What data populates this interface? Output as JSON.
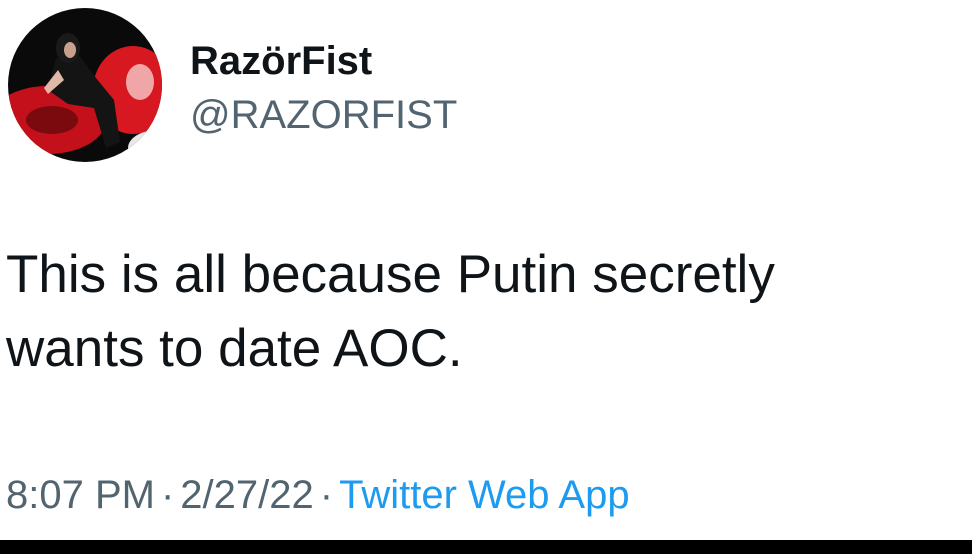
{
  "user": {
    "display_name": "RazörFist",
    "handle": "@RAZORFIST"
  },
  "tweet": {
    "text": "This is all because Putin secretly\nwants to date AOC."
  },
  "meta": {
    "time": "8:07 PM",
    "separator": "·",
    "date": "2/27/22",
    "source": "Twitter Web App"
  },
  "colors": {
    "text": "#0f1419",
    "secondary": "#536471",
    "link": "#1d9bf0",
    "avatar_red": "#c4101a"
  }
}
